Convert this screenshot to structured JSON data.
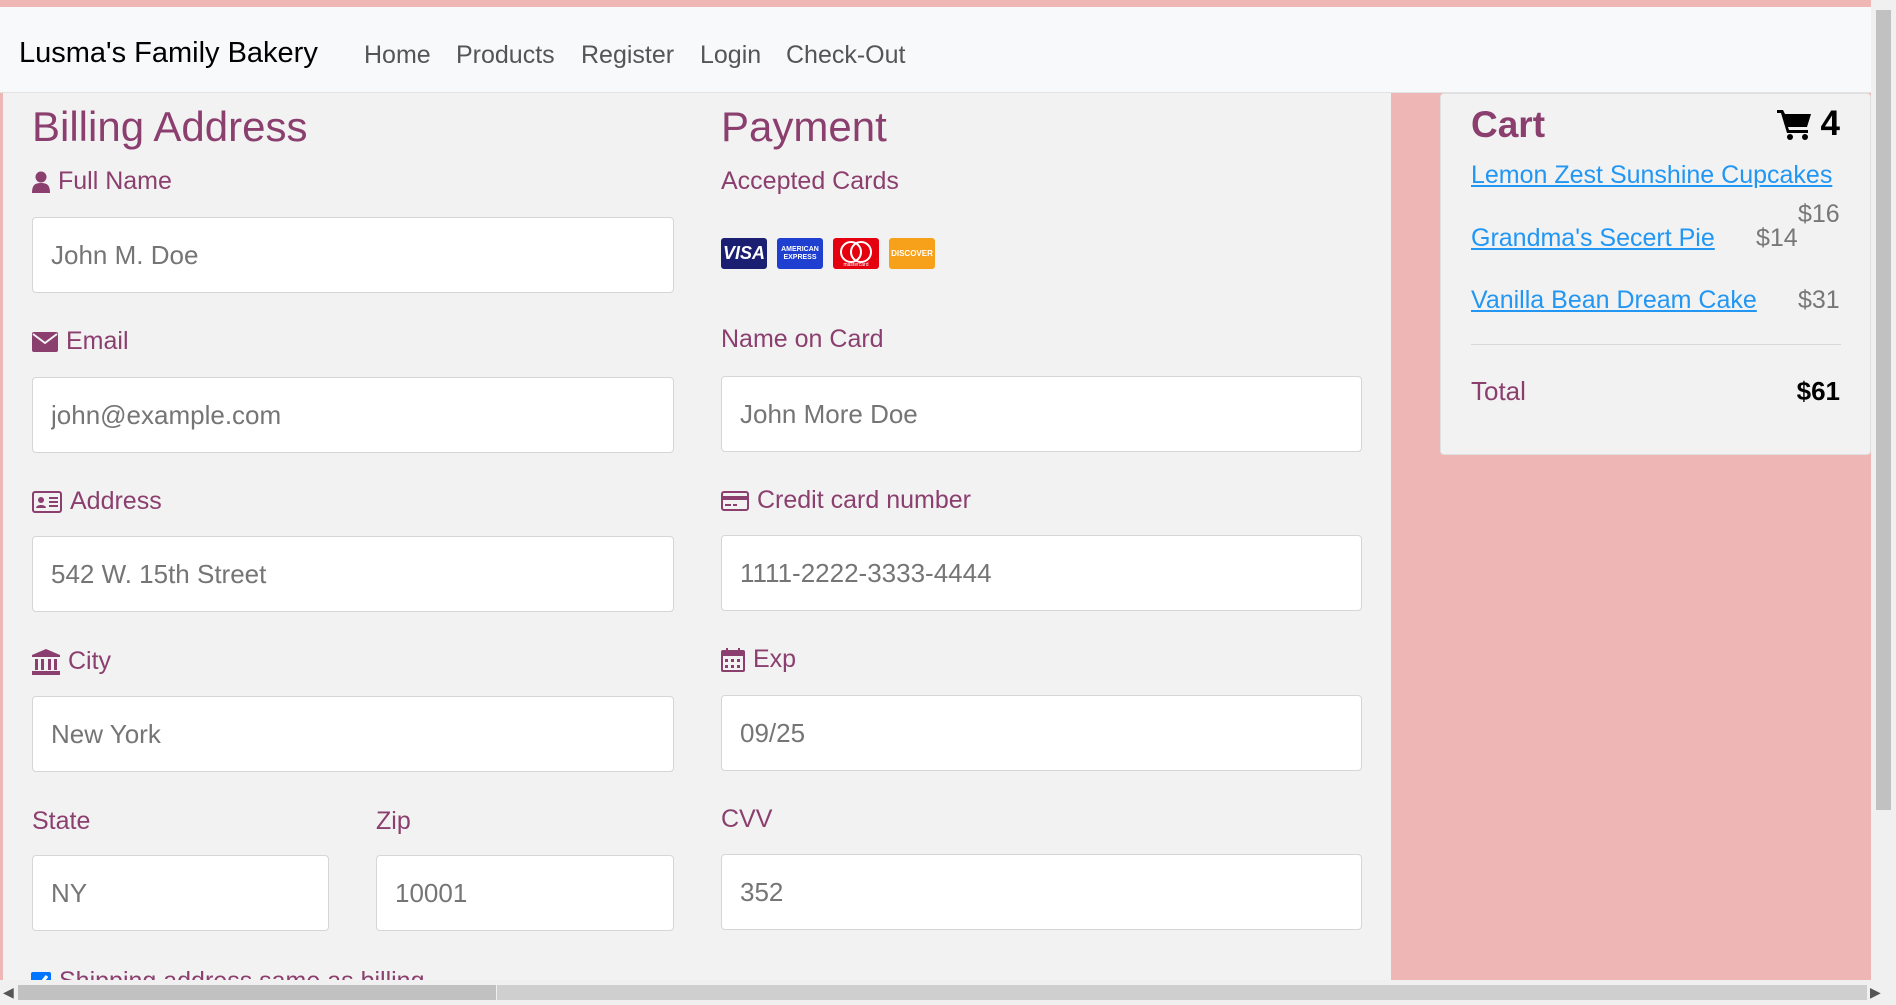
{
  "navbar": {
    "brand": "Lusma's Family Bakery",
    "links": [
      "Home",
      "Products",
      "Register",
      "Login",
      "Check-Out"
    ]
  },
  "billing": {
    "heading": "Billing Address",
    "full_name_label": "Full Name",
    "full_name_placeholder": "John M. Doe",
    "email_label": "Email",
    "email_placeholder": "john@example.com",
    "address_label": "Address",
    "address_placeholder": "542 W. 15th Street",
    "city_label": "City",
    "city_placeholder": "New York",
    "state_label": "State",
    "state_placeholder": "NY",
    "zip_label": "Zip",
    "zip_placeholder": "10001",
    "same_address_label": "Shipping address same as billing",
    "same_address_checked": true
  },
  "payment": {
    "heading": "Payment",
    "accepted_cards_label": "Accepted Cards",
    "cards": [
      "VISA",
      "AMERICAN EXPRESS",
      "mastercard",
      "DISCOVER"
    ],
    "name_on_card_label": "Name on Card",
    "name_on_card_placeholder": "John More Doe",
    "card_number_label": "Credit card number",
    "card_number_placeholder": "1111-2222-3333-4444",
    "exp_label": "Exp",
    "exp_placeholder": "09/25",
    "cvv_label": "CVV",
    "cvv_placeholder": "352"
  },
  "cart": {
    "title": "Cart",
    "count": "4",
    "items": [
      {
        "name": "Lemon Zest Sunshine Cupcakes",
        "price": "$16"
      },
      {
        "name": "Grandma's Secert Pie",
        "price": "$14"
      },
      {
        "name": "Vanilla Bean Dream Cake",
        "price": "$31"
      }
    ],
    "total_label": "Total",
    "total_value": "$61"
  },
  "colors": {
    "accent": "#8b3f6e",
    "link": "#2196f3",
    "page_bg": "#efb6b6",
    "panel_bg": "#f2f2f2"
  },
  "icons": [
    "user-icon",
    "envelope-icon",
    "address-card-icon",
    "institution-icon",
    "credit-card-icon",
    "calendar-icon",
    "shopping-cart-icon"
  ]
}
